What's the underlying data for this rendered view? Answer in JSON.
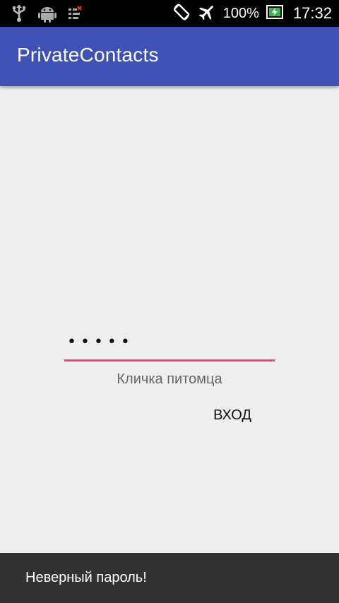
{
  "status_bar": {
    "icons_left": [
      "usb-icon",
      "android-debug-icon",
      "notification-icon"
    ],
    "icons_right": [
      "screen-rotation-icon",
      "airplane-mode-icon",
      "battery-charging-icon"
    ],
    "battery": "100%",
    "time": "17:32"
  },
  "app_bar": {
    "title": "PrivateContacts",
    "color": "#3f51b5"
  },
  "password_field": {
    "value": "•••••",
    "underline_color": "#ee407f",
    "hint": "Кличка питомца"
  },
  "login_button": {
    "label": "ВХОД"
  },
  "snackbar": {
    "message": "Неверный пароль!"
  }
}
